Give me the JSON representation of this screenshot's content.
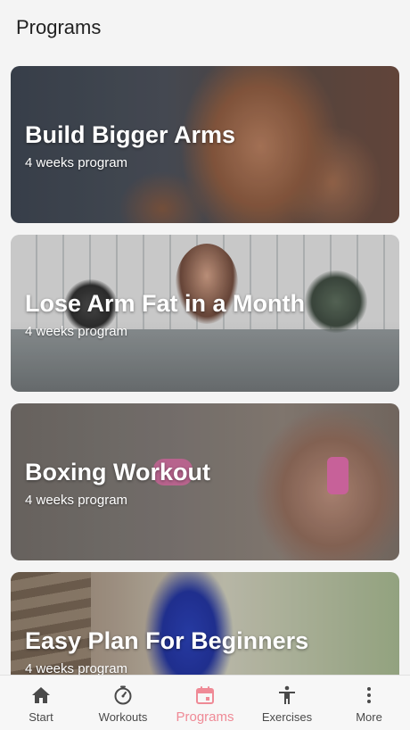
{
  "header": {
    "title": "Programs"
  },
  "programs": [
    {
      "title": "Build Bigger Arms",
      "subtitle": "4 weeks program"
    },
    {
      "title": "Lose Arm Fat in a Month",
      "subtitle": "4 weeks program"
    },
    {
      "title": "Boxing Workout",
      "subtitle": "4 weeks program"
    },
    {
      "title": "Easy Plan For Beginners",
      "subtitle": "4 weeks program"
    }
  ],
  "tabs": [
    {
      "label": "Start",
      "icon": "home-icon"
    },
    {
      "label": "Workouts",
      "icon": "timer-icon"
    },
    {
      "label": "Programs",
      "icon": "calendar-icon",
      "active": true
    },
    {
      "label": "Exercises",
      "icon": "person-icon"
    },
    {
      "label": "More",
      "icon": "more-vertical-icon"
    }
  ],
  "colors": {
    "accent": "#ef8a96",
    "text": "#212121",
    "background": "#f4f4f4"
  }
}
